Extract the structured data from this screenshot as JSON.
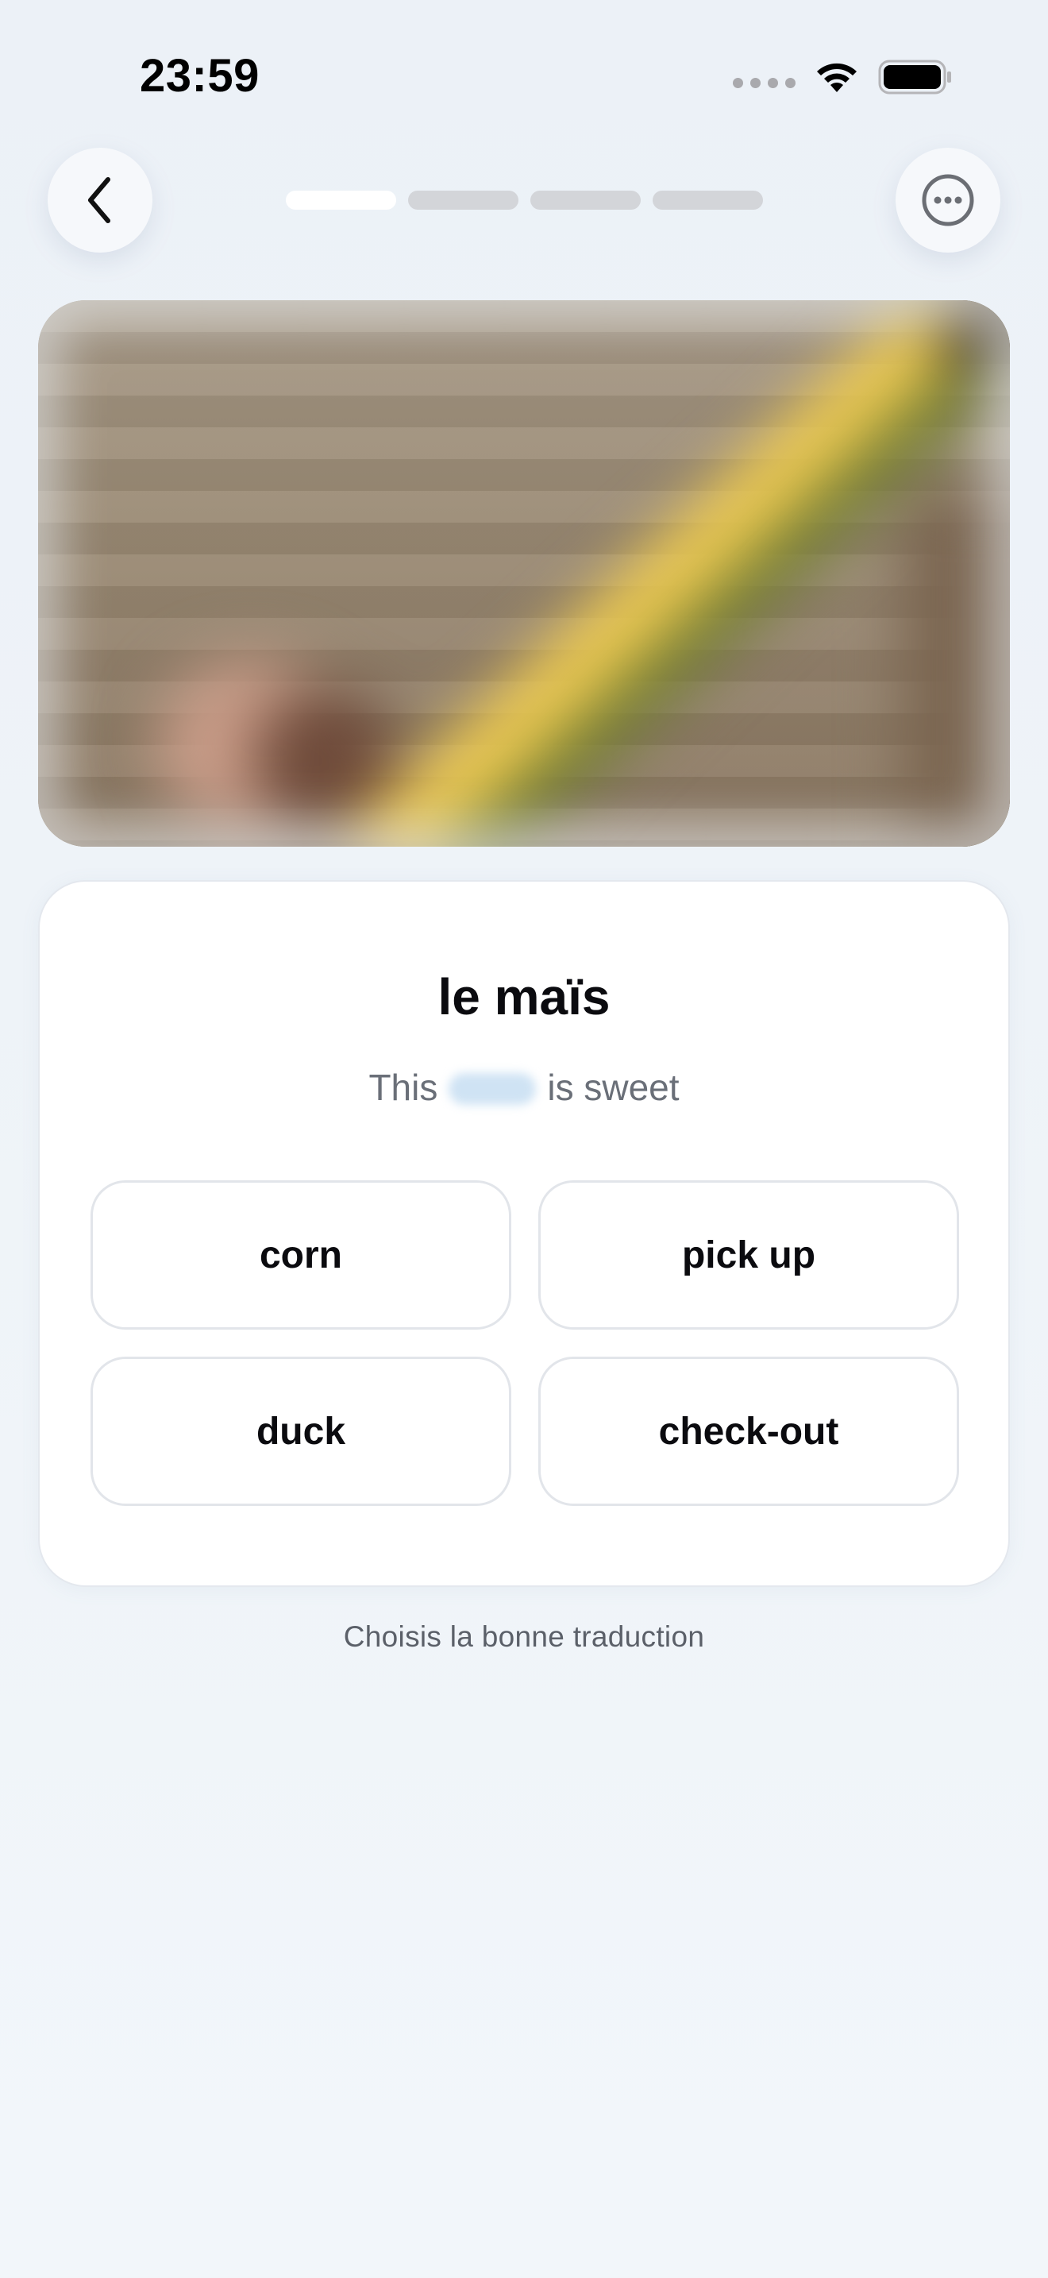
{
  "status_bar": {
    "time": "23:59",
    "icons": [
      "cellular-dots-icon",
      "wifi-icon",
      "battery-icon"
    ]
  },
  "nav": {
    "back_icon": "chevron-left-icon",
    "more_icon": "ellipsis-circle-icon",
    "progress": {
      "total_steps": 4,
      "current_step": 1
    }
  },
  "hero": {
    "description_icon": "blurred-corn-photo"
  },
  "question": {
    "word": "le maïs",
    "sentence_before": "This",
    "sentence_after": "is sweet"
  },
  "answers": [
    {
      "label": "corn"
    },
    {
      "label": "pick up"
    },
    {
      "label": "duck"
    },
    {
      "label": "check-out"
    }
  ],
  "instruction": "Choisis la bonne traduction",
  "colors": {
    "background": "#eef3f8",
    "card": "#ffffff",
    "progress_active": "#ffffff",
    "progress_inactive": "#d3d5d9",
    "text_primary": "#0b0b0f",
    "text_secondary": "#6a6f78"
  }
}
